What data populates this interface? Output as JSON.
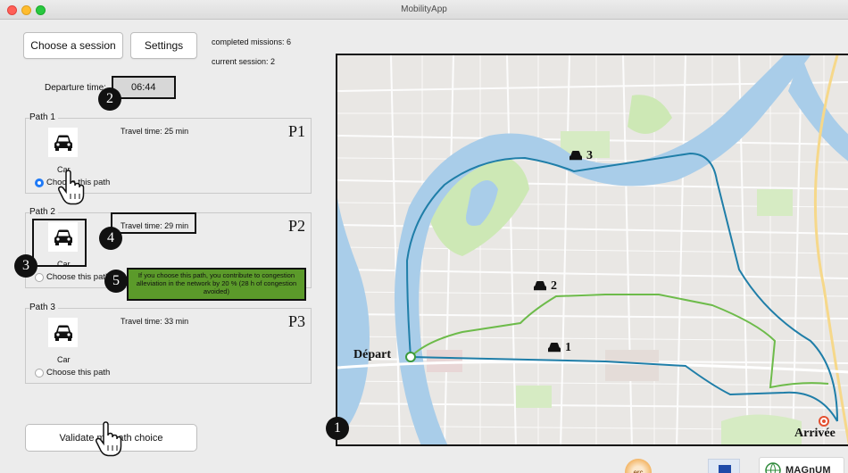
{
  "window": {
    "title": "MobilityApp"
  },
  "toolbar": {
    "choose_session_label": "Choose a session",
    "settings_label": "Settings",
    "completed_missions": "completed missions: 6",
    "current_session": "current session: 2"
  },
  "departure": {
    "label": "Departure time:",
    "value": "06:44"
  },
  "paths": [
    {
      "title": "Path 1",
      "travel_time": "Travel time: 25 min",
      "code": "P1",
      "mode": "Car",
      "radio_label": "Choose this path",
      "selected": true
    },
    {
      "title": "Path 2",
      "travel_time": "Travel time: 29 min",
      "code": "P2",
      "mode": "Car",
      "radio_label": "Choose this path",
      "selected": false,
      "note": "If you choose this path, you contribute to congestion alleviation in the network by 20 % (28 h of congestion avoided)"
    },
    {
      "title": "Path 3",
      "travel_time": "Travel time: 33 min",
      "code": "P3",
      "mode": "Car",
      "radio_label": "Choose this path",
      "selected": false
    }
  ],
  "validate_label": "Validate my path choice",
  "badges": [
    "1",
    "2",
    "3",
    "4",
    "5"
  ],
  "map": {
    "start_label": "Départ",
    "end_label": "Arrivée",
    "route_labels": [
      "1",
      "2",
      "3"
    ],
    "route_colors": {
      "route1": "#1f7ea8",
      "route2": "#6dbb4a",
      "route3": "#1f7ea8"
    }
  },
  "logos": {
    "erc": "erc",
    "magnum": "MAGnUM"
  },
  "icons": [
    "car-icon",
    "hand-pointer-icon",
    "start-marker-icon",
    "end-marker-icon"
  ]
}
